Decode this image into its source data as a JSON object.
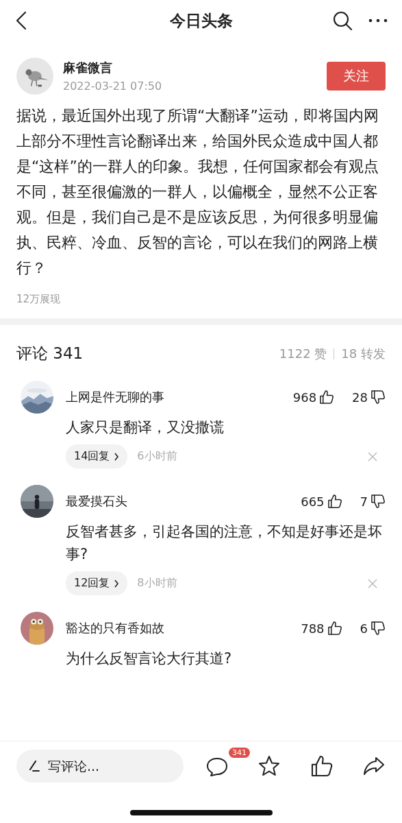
{
  "header": {
    "title": "今日头条"
  },
  "post": {
    "author": "麻雀微言",
    "date": "2022-03-21 07:50",
    "follow_button": "关注",
    "body": "据说，最近国外出现了所谓“大翻译”运动，即将国内网上部分不理性言论翻译出来，给国外民众造成中国人都是“这样”的一群人的印象。我想，任何国家都会有观点不同，甚至很偏激的一群人，以偏概全，显然不公正客观。但是，我们自己是不是应该反思，为何很多明显偏执、民粹、冷血、反智的言论，可以在我们的网路上横行？",
    "views": "12万展现"
  },
  "comments_header": {
    "title": "评论 341",
    "likes": "1122 赞",
    "shares": "18 转发"
  },
  "comments": [
    {
      "author": "上网是件无聊的事",
      "likes": "968",
      "dislikes": "28",
      "text": "人家只是翻译，又没撒谎",
      "replies": "14回复",
      "time": "6小时前"
    },
    {
      "author": "最爱摸石头",
      "likes": "665",
      "dislikes": "7",
      "text": "反智者甚多，引起各国的注意，不知是好事还是坏事?",
      "replies": "12回复",
      "time": "8小时前"
    },
    {
      "author": "豁达的只有香如故",
      "likes": "788",
      "dislikes": "6",
      "text": "为什么反智言论大行其道?"
    }
  ],
  "bottom_bar": {
    "placeholder": "写评论...",
    "comment_badge": "341"
  }
}
